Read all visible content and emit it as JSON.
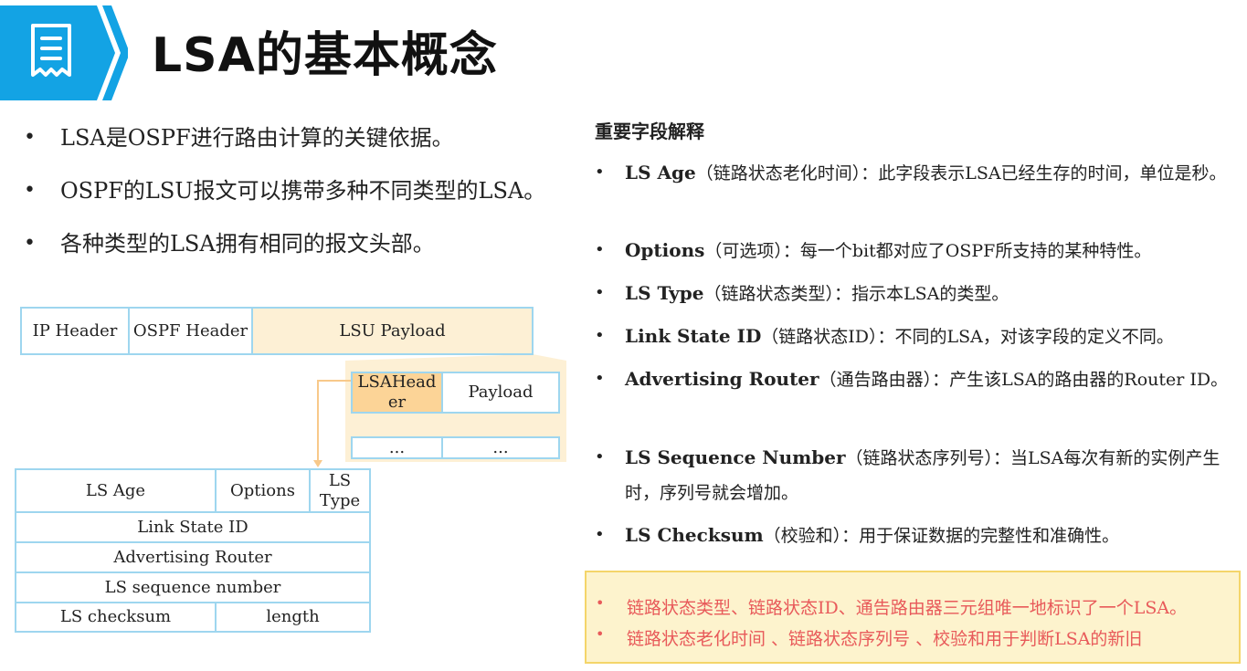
{
  "title": "LSA的基本概念",
  "left_bullets": [
    "LSA是OSPF进行路由计算的关键依据。",
    "OSPF的LSU报文可以携带多种不同类型的LSA。",
    "各种类型的LSA拥有相同的报文头部。"
  ],
  "diagram": {
    "ip_header": "IP Header",
    "ospf_header": "OSPF Header",
    "lsu_payload": "LSU Payload",
    "lsa_header": "LSAHeader",
    "payload": "Payload",
    "ellipsis_1": "...",
    "ellipsis_2": "...",
    "fields": {
      "ls_age": "LS Age",
      "options": "Options",
      "ls_type": "LS Type",
      "link_state_id": "Link State ID",
      "advertising_router": "Advertising Router",
      "ls_sequence_number": "LS sequence number",
      "ls_checksum": "LS checksum",
      "length": "length"
    }
  },
  "field_explain": {
    "heading": "重要字段解释",
    "items": [
      {
        "name": "LS Age",
        "desc": "（链路状态老化时间）：此字段表示LSA已经生存的时间，单位是秒。"
      },
      {
        "name": "Options",
        "desc": "（可选项）：每一个bit都对应了OSPF所支持的某种特性。"
      },
      {
        "name": "LS Type",
        "desc": "（链路状态类型）：指示本LSA的类型。"
      },
      {
        "name": "Link State ID",
        "desc": "（链路状态ID）：不同的LSA，对该字段的定义不同。"
      },
      {
        "name": "Advertising Router",
        "desc": "（通告路由器）：产生该LSA的路由器的Router ID。"
      },
      {
        "name": "LS Sequence Number",
        "desc": "（链路状态序列号）：当LSA每次有新的实例产生时，序列号就会增加。"
      },
      {
        "name": "LS Checksum",
        "desc": "（校验和）：用于保证数据的完整性和准确性。"
      }
    ]
  },
  "notes": [
    "链路状态类型、链路状态ID、通告路由器三元组唯一地标识了一个LSA。",
    "链路状态老化时间 、链路状态序列号 、校验和用于判断LSA的新旧"
  ],
  "colors": {
    "accent_blue": "#13a3e4",
    "box_border": "#9ed6ef",
    "cream": "#fdf0d5",
    "lsa_header_fill": "#fcd497",
    "note_bg": "#fdf3cd",
    "note_text": "#e85a5a"
  },
  "icons": {
    "banner": "document-list-icon"
  }
}
